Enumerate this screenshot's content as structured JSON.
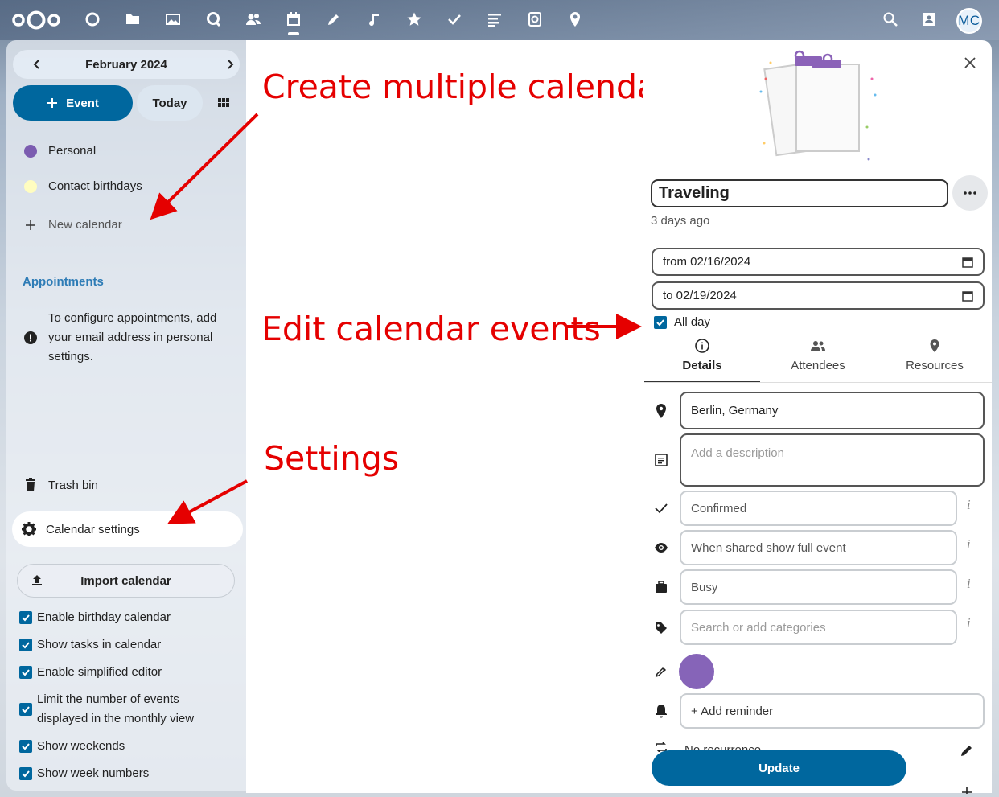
{
  "topbar": {
    "apps": [
      "dashboard",
      "files",
      "photos",
      "talk",
      "contacts",
      "calendar",
      "notes",
      "music",
      "bookmarks",
      "tasks",
      "deck",
      "forms",
      "maps"
    ],
    "avatar_initials": "MC"
  },
  "sidebar": {
    "month": "February 2024",
    "new_event_label": "Event",
    "today_label": "Today",
    "calendars": [
      {
        "name": "Personal",
        "color": "#7b5cb0"
      },
      {
        "name": "Contact birthdays",
        "color": "#fffdc0"
      }
    ],
    "new_calendar_label": "New calendar",
    "appointments_heading": "Appointments",
    "appointments_text": "To configure appointments, add your email address in personal settings.",
    "trash_label": "Trash bin",
    "settings_label": "Calendar settings",
    "import_label": "Import calendar",
    "options": [
      {
        "label": "Enable birthday calendar",
        "checked": true
      },
      {
        "label": "Show tasks in calendar",
        "checked": true
      },
      {
        "label": "Enable simplified editor",
        "checked": true
      },
      {
        "label": "Limit the number of events displayed in the monthly view",
        "checked": true
      },
      {
        "label": "Show weekends",
        "checked": true
      },
      {
        "label": "Show week numbers",
        "checked": true
      }
    ]
  },
  "annotations": {
    "multiple_calendars": "Create multiple calendars",
    "edit_events": "Edit calendar events",
    "settings": "Settings"
  },
  "event": {
    "title": "Traveling",
    "modified": "3 days ago",
    "from": "from 02/16/2024",
    "to": "to 02/19/2024",
    "all_day_label": "All day",
    "tabs": [
      "Details",
      "Attendees",
      "Resources"
    ],
    "location": "Berlin, Germany",
    "description_placeholder": "Add a description",
    "status": "Confirmed",
    "access": "When shared show full event",
    "availability": "Busy",
    "categories_placeholder": "Search or add categories",
    "color": "#8664b8",
    "reminder_label": "+ Add reminder",
    "recurrence": "No recurrence",
    "update_label": "Update"
  },
  "colors": {
    "primary": "#00679e",
    "annotation": "#e50000"
  }
}
